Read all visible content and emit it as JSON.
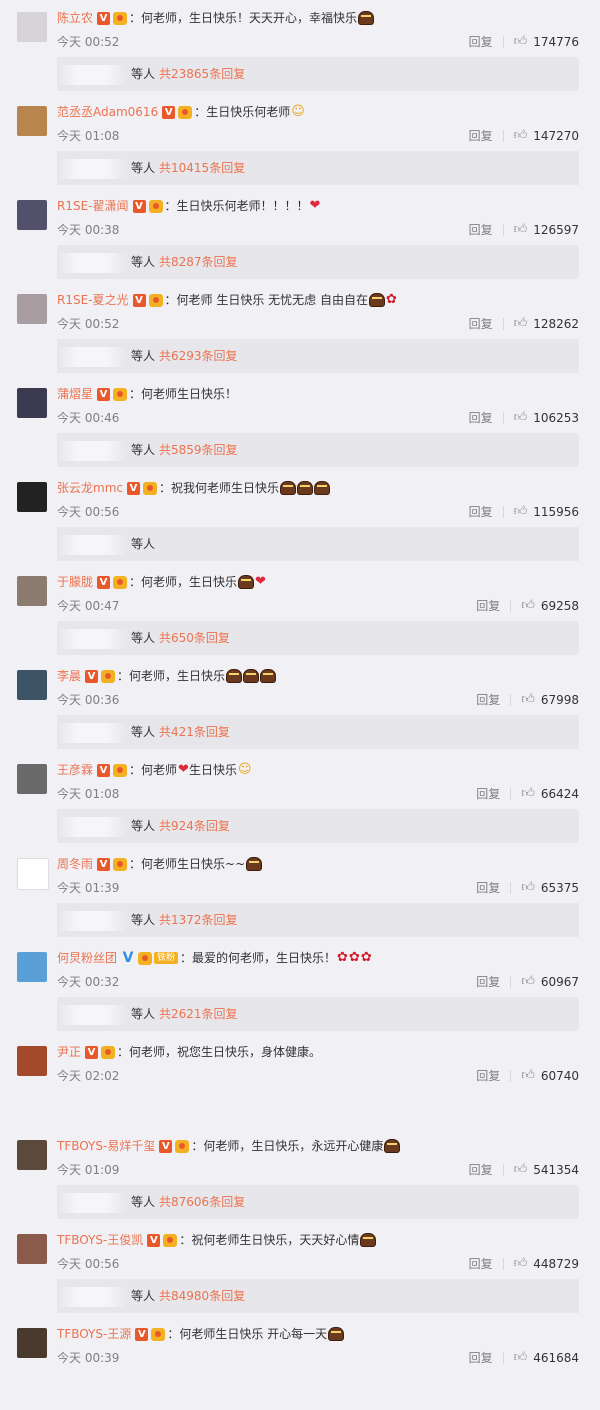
{
  "comments": [
    {
      "user": "陈立农",
      "text": "：何老师，生日快乐！天天开心，幸福快乐",
      "emoji": "cake",
      "time": "今天 00:52",
      "reply": "回复",
      "likes": "174776",
      "etc": "等人",
      "total": "共23865条回复",
      "avatar_color": "#d7d4d9"
    },
    {
      "user": "范丞丞Adam0616",
      "text": "：生日快乐何老师",
      "emoji": "smile",
      "time": "今天 01:08",
      "reply": "回复",
      "likes": "147270",
      "etc": "等人",
      "total": "共10415条回复",
      "avatar_color": "#b8864c"
    },
    {
      "user": "R1SE-翟潇闻",
      "text": "：生日快乐何老师！！！！",
      "emoji": "heart",
      "time": "今天 00:38",
      "reply": "回复",
      "likes": "126597",
      "etc": "等人",
      "total": "共8287条回复",
      "avatar_color": "#52506a"
    },
    {
      "user": "R1SE-夏之光",
      "text": "：何老师 生日快乐 无忧无虑 自由自在",
      "emoji": "cake-rose",
      "time": "今天 00:52",
      "reply": "回复",
      "likes": "128262",
      "etc": "等人",
      "total": "共6293条回复",
      "avatar_color": "#a89da1"
    },
    {
      "user": "蒲熠星",
      "text": "：何老师生日快乐！",
      "emoji": "",
      "time": "今天 00:46",
      "reply": "回复",
      "likes": "106253",
      "etc": "等人",
      "total": "共5859条回复",
      "avatar_color": "#3c3a51"
    },
    {
      "user": "张云龙mmc",
      "text": "：祝我何老师生日快乐",
      "emoji": "cake3",
      "time": "今天 00:56",
      "reply": "回复",
      "likes": "115956",
      "etc": "等人",
      "total": "",
      "avatar_color": "#222222"
    },
    {
      "user": "于朦胧",
      "text": "：何老师，生日快乐",
      "emoji": "cake-heart",
      "time": "今天 00:47",
      "reply": "回复",
      "likes": "69258",
      "etc": "等人",
      "total": "共650条回复",
      "avatar_color": "#8c7b70"
    },
    {
      "user": "李晨",
      "text": "：何老师，生日快乐",
      "emoji": "cake3",
      "time": "今天 00:36",
      "reply": "回复",
      "likes": "67998",
      "etc": "等人",
      "total": "共421条回复",
      "avatar_color": "#3d5366"
    },
    {
      "user": "王彦霖",
      "text": "：何老师",
      "emoji": "heart-mid",
      "text2": "生日快乐",
      "time": "今天 01:08",
      "reply": "回复",
      "likes": "66424",
      "etc": "等人",
      "total": "共924条回复",
      "avatar_color": "#6a6a6a"
    },
    {
      "user": "周冬雨",
      "text": "：何老师生日快乐~~",
      "emoji": "cake",
      "time": "今天 01:39",
      "reply": "回复",
      "likes": "65375",
      "etc": "等人",
      "total": "共1372条回复",
      "avatar_color": "#ffffff"
    },
    {
      "user": "何炅粉丝团",
      "text": "：最爱的何老师，生日快乐！",
      "emoji": "rose3",
      "time": "今天 00:32",
      "reply": "回复",
      "likes": "60967",
      "etc": "等人",
      "total": "共2621条回复",
      "avatar_color": "#5aa0d6",
      "fan": "铁粉",
      "blue": true
    },
    {
      "user": "尹正",
      "text": "：何老师，祝您生日快乐，身体健康。",
      "emoji": "",
      "time": "今天 02:02",
      "reply": "回复",
      "likes": "60740",
      "etc": "",
      "total": "",
      "avatar_color": "#a44a2a"
    },
    {
      "user": "TFBOYS-易烊千玺",
      "text": "：何老师，生日快乐，永远开心健康",
      "emoji": "cake",
      "time": "今天 01:09",
      "reply": "回复",
      "likes": "541354",
      "etc": "等人",
      "total": "共87606条回复",
      "avatar_color": "#5b4a3a"
    },
    {
      "user": "TFBOYS-王俊凯",
      "text": "：祝何老师生日快乐，天天好心情",
      "emoji": "cake",
      "time": "今天 00:56",
      "reply": "回复",
      "likes": "448729",
      "etc": "等人",
      "total": "共84980条回复",
      "avatar_color": "#8a5a4a"
    },
    {
      "user": "TFBOYS-王源",
      "text": "：何老师生日快乐 开心每一天",
      "emoji": "cake",
      "time": "今天 00:39",
      "reply": "回复",
      "likes": "461684",
      "etc": "",
      "total": "",
      "avatar_color": "#4a3a2e"
    }
  ]
}
